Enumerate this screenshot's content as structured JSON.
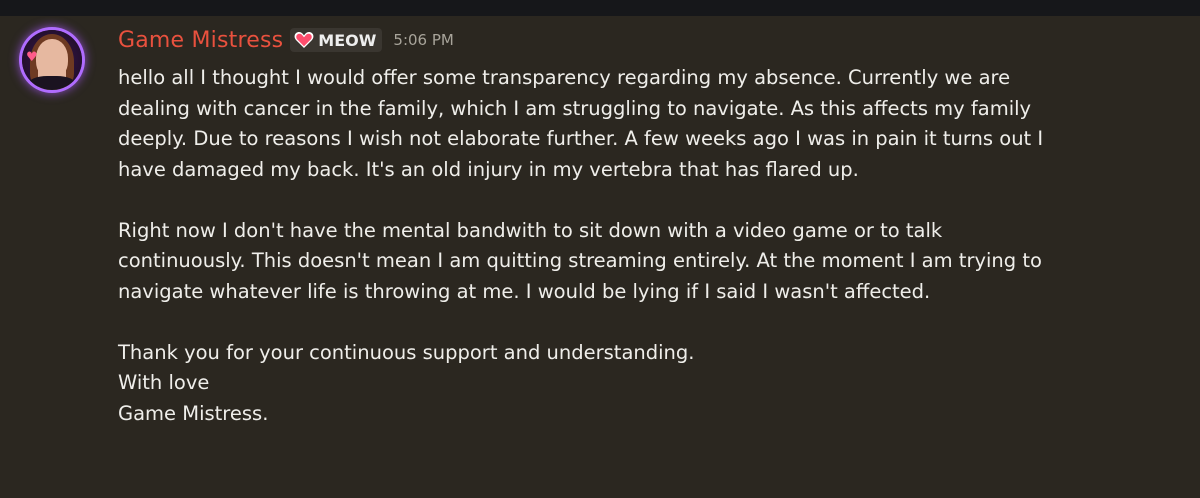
{
  "message": {
    "author": "Game Mistress",
    "role_tag": {
      "icon": "heart-icon",
      "label": "MEOW",
      "color": "#ff4d6d"
    },
    "timestamp": "5:06 PM",
    "author_color": "#e9513e",
    "paragraphs": [
      [
        "hello all I thought I would offer some transparency regarding my absence. Currently we are",
        "dealing with cancer in the family, which I am struggling to navigate. As this affects my family",
        "deeply. Due to reasons I wish not elaborate further. A few weeks ago I was in pain it turns out I",
        "have damaged my back. It's an old injury in my vertebra that has flared up."
      ],
      [
        "Right now I don't have the mental bandwith to sit down with a video game or to talk",
        "continuously.  This doesn't mean I am quitting streaming entirely. At the moment I am trying to",
        "navigate whatever life is throwing at me. I would be lying if I said I wasn't affected."
      ],
      [
        "Thank you for your continuous support and understanding.",
        "With love",
        "Game Mistress."
      ]
    ]
  }
}
